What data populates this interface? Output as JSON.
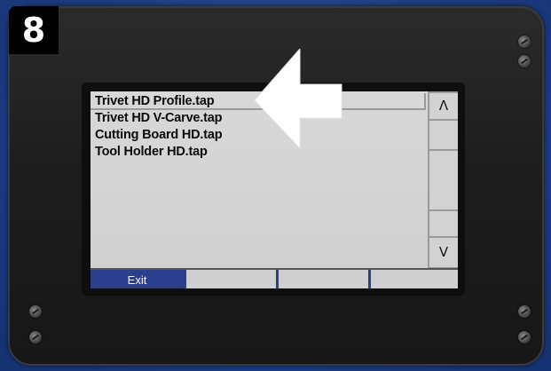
{
  "step_badge": "8",
  "files": [
    {
      "name": "Trivet HD Profile.tap",
      "selected": true
    },
    {
      "name": "Trivet HD V-Carve.tap",
      "selected": false
    },
    {
      "name": "Cutting Board HD.tap",
      "selected": false
    },
    {
      "name": "Tool Holder HD.tap",
      "selected": false
    }
  ],
  "scroll": {
    "up_label": "Λ",
    "down_label": "V"
  },
  "softkeys": [
    {
      "label": "Exit",
      "active": true
    },
    {
      "label": "",
      "active": false
    },
    {
      "label": "",
      "active": false
    },
    {
      "label": "",
      "active": false
    }
  ],
  "colors": {
    "background": "#1f3f82",
    "softkey_active": "#2c3e8e",
    "screen": "#d4d4d4",
    "arrow": "#ffffff"
  },
  "annotation": {
    "icon": "left-arrow-icon"
  }
}
